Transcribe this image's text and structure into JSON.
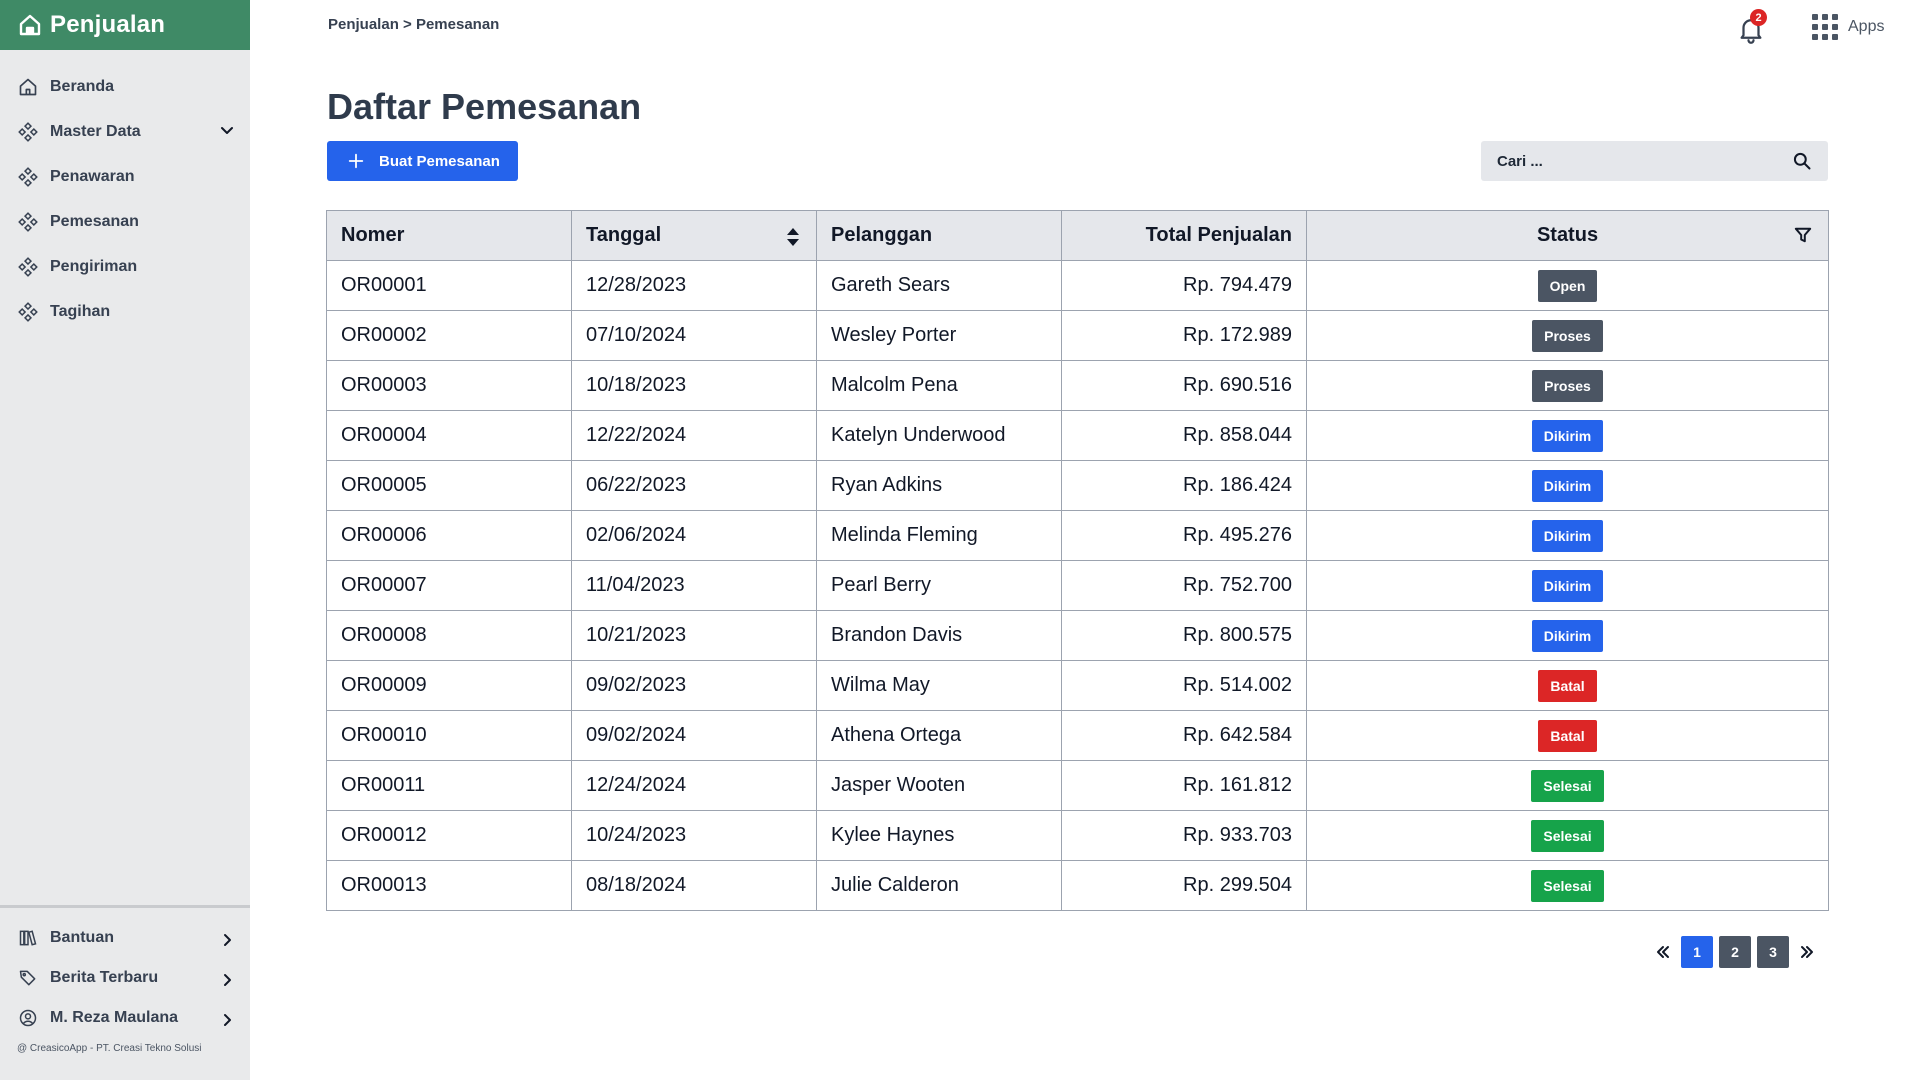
{
  "app": {
    "title": "Penjualan",
    "copyright": "@ CreasicoApp - PT. Creasi Tekno Solusi"
  },
  "sidebar": {
    "items": [
      {
        "label": "Beranda",
        "icon": "home-icon"
      },
      {
        "label": "Master Data",
        "icon": "diamond-dots-icon",
        "expandable": true
      },
      {
        "label": "Penawaran",
        "icon": "diamond-dots-icon"
      },
      {
        "label": "Pemesanan",
        "icon": "diamond-dots-icon"
      },
      {
        "label": "Pengiriman",
        "icon": "diamond-dots-icon"
      },
      {
        "label": "Tagihan",
        "icon": "diamond-dots-icon"
      }
    ],
    "bottom_items": [
      {
        "label": "Bantuan",
        "icon": "books-icon"
      },
      {
        "label": "Berita Terbaru",
        "icon": "tags-icon"
      },
      {
        "label": "M. Reza Maulana",
        "icon": "user-circle-icon"
      }
    ]
  },
  "header": {
    "breadcrumb": "Penjualan > Pemesanan",
    "notification_count": "2",
    "apps_label": "Apps"
  },
  "page": {
    "title": "Daftar Pemesanan",
    "create_button": "Buat Pemesanan",
    "search_placeholder": "Cari ..."
  },
  "table": {
    "columns": [
      "Nomer",
      "Tanggal",
      "Pelanggan",
      "Total Penjualan",
      "Status"
    ],
    "rows": [
      {
        "nomer": "OR00001",
        "tanggal": "12/28/2023",
        "pelanggan": "Gareth Sears",
        "total": "Rp. 794.479",
        "status": "Open",
        "status_class": "st-open"
      },
      {
        "nomer": "OR00002",
        "tanggal": "07/10/2024",
        "pelanggan": "Wesley Porter",
        "total": "Rp. 172.989",
        "status": "Proses",
        "status_class": "st-proses"
      },
      {
        "nomer": "OR00003",
        "tanggal": "10/18/2023",
        "pelanggan": "Malcolm Pena",
        "total": "Rp. 690.516",
        "status": "Proses",
        "status_class": "st-proses"
      },
      {
        "nomer": "OR00004",
        "tanggal": "12/22/2024",
        "pelanggan": "Katelyn Underwood",
        "total": "Rp. 858.044",
        "status": "Dikirim",
        "status_class": "st-dikirim"
      },
      {
        "nomer": "OR00005",
        "tanggal": "06/22/2023",
        "pelanggan": "Ryan Adkins",
        "total": "Rp. 186.424",
        "status": "Dikirim",
        "status_class": "st-dikirim"
      },
      {
        "nomer": "OR00006",
        "tanggal": "02/06/2024",
        "pelanggan": "Melinda Fleming",
        "total": "Rp. 495.276",
        "status": "Dikirim",
        "status_class": "st-dikirim"
      },
      {
        "nomer": "OR00007",
        "tanggal": "11/04/2023",
        "pelanggan": "Pearl Berry",
        "total": "Rp. 752.700",
        "status": "Dikirim",
        "status_class": "st-dikirim"
      },
      {
        "nomer": "OR00008",
        "tanggal": "10/21/2023",
        "pelanggan": "Brandon Davis",
        "total": "Rp. 800.575",
        "status": "Dikirim",
        "status_class": "st-dikirim"
      },
      {
        "nomer": "OR00009",
        "tanggal": "09/02/2023",
        "pelanggan": "Wilma May",
        "total": "Rp. 514.002",
        "status": "Batal",
        "status_class": "st-batal"
      },
      {
        "nomer": "OR00010",
        "tanggal": "09/02/2024",
        "pelanggan": "Athena Ortega",
        "total": "Rp. 642.584",
        "status": "Batal",
        "status_class": "st-batal"
      },
      {
        "nomer": "OR00011",
        "tanggal": "12/24/2024",
        "pelanggan": "Jasper Wooten",
        "total": "Rp. 161.812",
        "status": "Selesai",
        "status_class": "st-selesai"
      },
      {
        "nomer": "OR00012",
        "tanggal": "10/24/2023",
        "pelanggan": "Kylee Haynes",
        "total": "Rp. 933.703",
        "status": "Selesai",
        "status_class": "st-selesai"
      },
      {
        "nomer": "OR00013",
        "tanggal": "08/18/2024",
        "pelanggan": "Julie Calderon",
        "total": "Rp. 299.504",
        "status": "Selesai",
        "status_class": "st-selesai"
      }
    ]
  },
  "pagination": {
    "pages": [
      "1",
      "2",
      "3"
    ],
    "current": "1"
  },
  "colors": {
    "brand": "#3f8a66",
    "primary": "#2563eb",
    "danger": "#dc2626",
    "success": "#16a34a",
    "neutral": "#4b5563"
  }
}
